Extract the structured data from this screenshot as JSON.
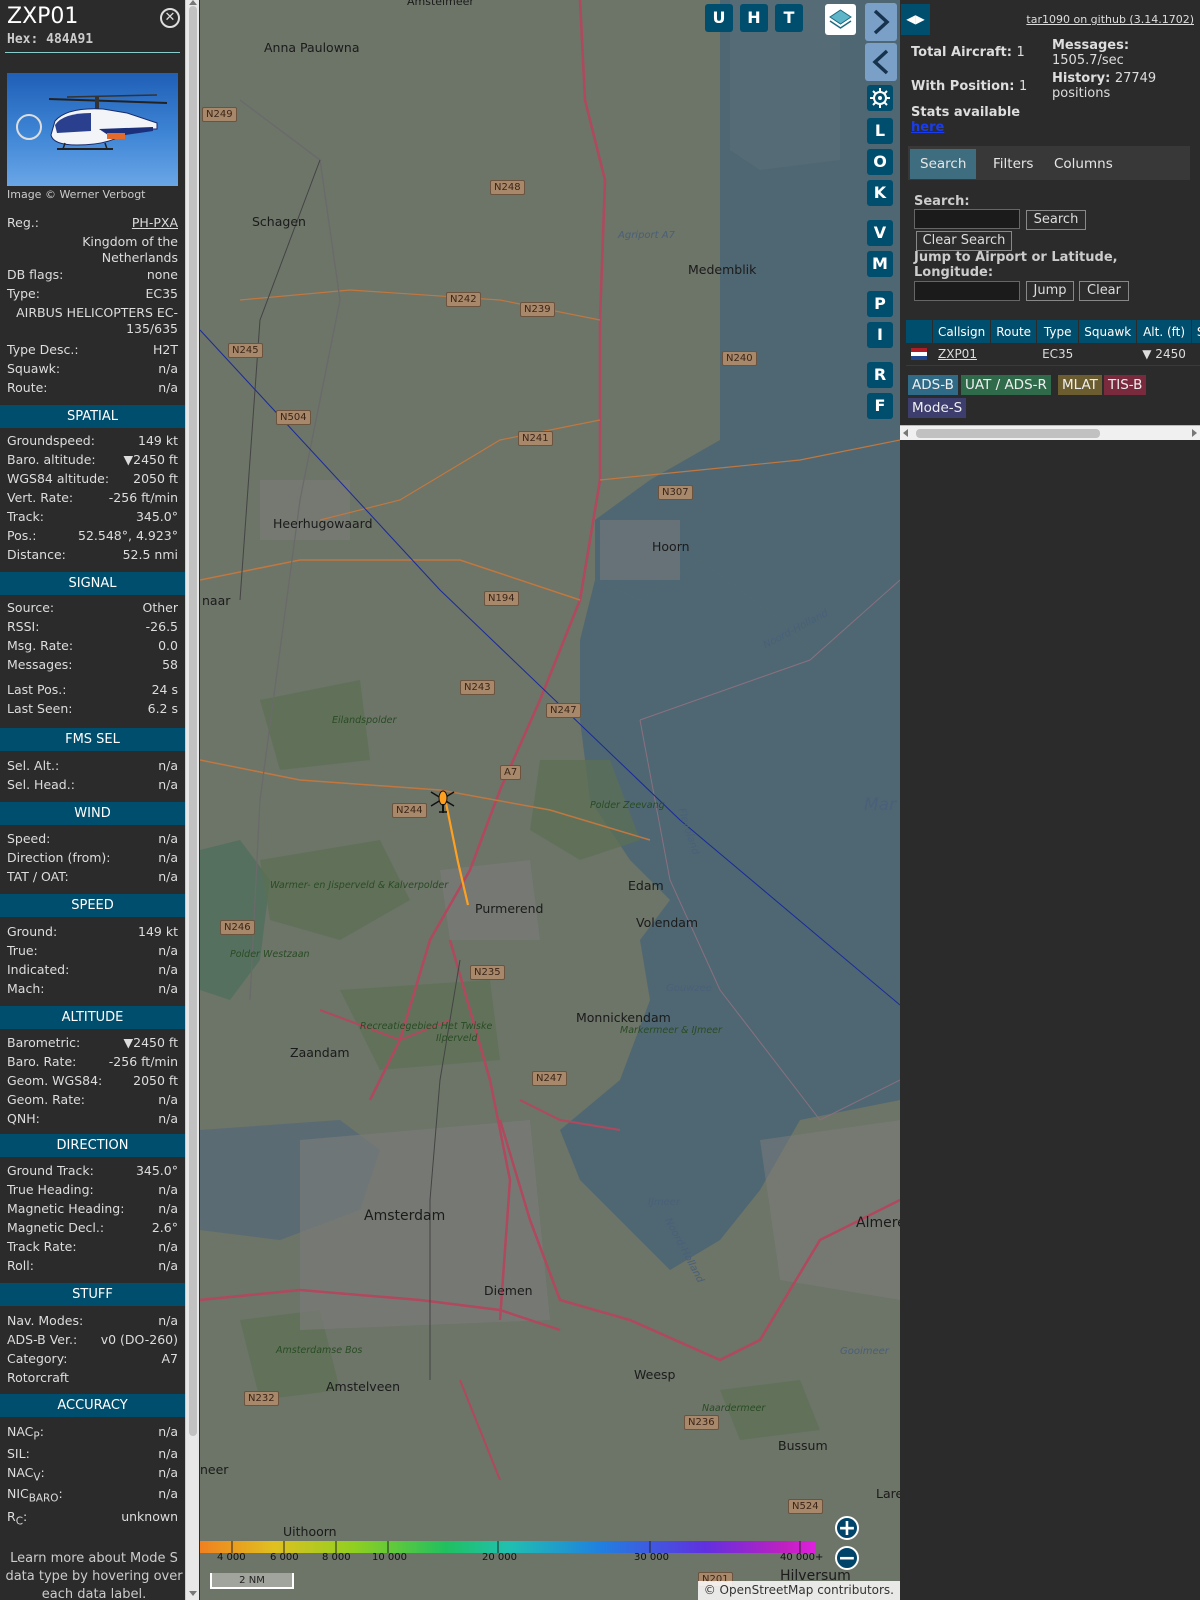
{
  "info": {
    "callsign": "ZXP01",
    "hex": "Hex: 484A91",
    "photo_credit": "Image © Werner Verbogt",
    "rows_top": [
      {
        "k": "Reg.:",
        "v": "PH-PXA"
      },
      {
        "k": "",
        "v": "Kingdom of the Netherlands"
      },
      {
        "k": "DB flags:",
        "v": "none"
      },
      {
        "k": "Type:",
        "v": "EC35"
      },
      {
        "k": "",
        "v": "AIRBUS HELICOPTERS EC-135/635"
      },
      {
        "k": "Type Desc.:",
        "v": "H2T"
      },
      {
        "k": "Squawk:",
        "v": "n/a"
      },
      {
        "k": "Route:",
        "v": "n/a"
      }
    ],
    "sections": {
      "spatial": "SPATIAL",
      "signal": "SIGNAL",
      "fms": "FMS SEL",
      "wind": "WIND",
      "speed": "SPEED",
      "altitude": "ALTITUDE",
      "direction": "DIRECTION",
      "stuff": "STUFF",
      "accuracy": "ACCURACY"
    },
    "spatial": [
      {
        "k": "Groundspeed:",
        "v": "149 kt"
      },
      {
        "k": "Baro. altitude:",
        "v": "▼2450 ft"
      },
      {
        "k": "WGS84 altitude:",
        "v": "2050 ft"
      },
      {
        "k": "Vert. Rate:",
        "v": "-256 ft/min"
      },
      {
        "k": "Track:",
        "v": "345.0°"
      },
      {
        "k": "Pos.:",
        "v": "52.548°, 4.923°"
      },
      {
        "k": "Distance:",
        "v": "52.5 nmi"
      }
    ],
    "signal": [
      {
        "k": "Source:",
        "v": "Other"
      },
      {
        "k": "RSSI:",
        "v": "-26.5"
      },
      {
        "k": "Msg. Rate:",
        "v": "0.0"
      },
      {
        "k": "Messages:",
        "v": "58"
      },
      {
        "k": "Last Pos.:",
        "v": "24 s"
      },
      {
        "k": "Last Seen:",
        "v": "6.2 s"
      }
    ],
    "fms": [
      {
        "k": "Sel. Alt.:",
        "v": "n/a"
      },
      {
        "k": "Sel. Head.:",
        "v": "n/a"
      }
    ],
    "wind": [
      {
        "k": "Speed:",
        "v": "n/a"
      },
      {
        "k": "Direction (from):",
        "v": "n/a"
      },
      {
        "k": "TAT / OAT:",
        "v": "n/a"
      }
    ],
    "speed": [
      {
        "k": "Ground:",
        "v": "149 kt"
      },
      {
        "k": "True:",
        "v": "n/a"
      },
      {
        "k": "Indicated:",
        "v": "n/a"
      },
      {
        "k": "Mach:",
        "v": "n/a"
      }
    ],
    "altitude": [
      {
        "k": "Barometric:",
        "v": "▼2450 ft"
      },
      {
        "k": "Baro. Rate:",
        "v": "-256 ft/min"
      },
      {
        "k": "Geom. WGS84:",
        "v": "2050 ft"
      },
      {
        "k": "Geom. Rate:",
        "v": "n/a"
      },
      {
        "k": "QNH:",
        "v": "n/a"
      }
    ],
    "direction": [
      {
        "k": "Ground Track:",
        "v": "345.0°"
      },
      {
        "k": "True Heading:",
        "v": "n/a"
      },
      {
        "k": "Magnetic Heading:",
        "v": "n/a"
      },
      {
        "k": "Magnetic Decl.:",
        "v": "2.6°"
      },
      {
        "k": "Track Rate:",
        "v": "n/a"
      },
      {
        "k": "Roll:",
        "v": "n/a"
      }
    ],
    "stuff": [
      {
        "k": "Nav. Modes:",
        "v": "n/a"
      },
      {
        "k": "ADS-B Ver.:",
        "v": "v0 (DO-260)"
      },
      {
        "k": "Category:",
        "v": "A7"
      },
      {
        "k": "Rotorcraft",
        "v": ""
      }
    ],
    "accuracy": [
      {
        "k": "NAC",
        "sub": "P",
        "v": "n/a"
      },
      {
        "k": "SIL:",
        "sub": "",
        "v": "n/a"
      },
      {
        "k": "NAC",
        "sub": "V",
        "v": "n/a"
      },
      {
        "k": "NIC",
        "sub": "BARO",
        "v": "n/a"
      },
      {
        "k": "R",
        "sub": "C",
        "v": "unknown"
      }
    ],
    "footnote": "Learn more about Mode S data type by hovering over each data label."
  },
  "map": {
    "buttons": {
      "u": "U",
      "h": "H",
      "t": "T",
      "l": "L",
      "o": "O",
      "k": "K",
      "v": "V",
      "m": "M",
      "p": "P",
      "i": "I",
      "r": "R",
      "f": "F"
    },
    "places": [
      {
        "id": "amstelmeer",
        "t": "Amstelmeer"
      },
      {
        "id": "anna",
        "t": "Anna Paulowna"
      },
      {
        "id": "schagen",
        "t": "Schagen"
      },
      {
        "id": "agriport",
        "t": "Agriport A7"
      },
      {
        "id": "medemblik",
        "t": "Medemblik"
      },
      {
        "id": "heerhugowaard",
        "t": "Heerhugowaard"
      },
      {
        "id": "hoorn",
        "t": "Hoorn"
      },
      {
        "id": "naar",
        "t": "naar"
      },
      {
        "id": "eilandspolder",
        "t": "Eilandspolder"
      },
      {
        "id": "purmerend",
        "t": "Purmerend"
      },
      {
        "id": "edam",
        "t": "Edam"
      },
      {
        "id": "volendam",
        "t": "Volendam"
      },
      {
        "id": "zaandam",
        "t": "Zaandam"
      },
      {
        "id": "monnickendam",
        "t": "Monnickendam"
      },
      {
        "id": "amsterdam",
        "t": "Amsterdam"
      },
      {
        "id": "diemen",
        "t": "Diemen"
      },
      {
        "id": "amstelveen",
        "t": "Amstelveen"
      },
      {
        "id": "weesp",
        "t": "Weesp"
      },
      {
        "id": "bussum",
        "t": "Bussum"
      },
      {
        "id": "hilversum",
        "t": "Hilversum"
      },
      {
        "id": "uithoorn",
        "t": "Uithoorn"
      },
      {
        "id": "almere",
        "t": "Almere"
      },
      {
        "id": "marken",
        "t": "Mar"
      },
      {
        "id": "neer",
        "t": "neer"
      },
      {
        "id": "laren",
        "t": "Larer"
      }
    ],
    "water": [
      {
        "id": "noordholland1",
        "t": "Noord-Holland"
      },
      {
        "id": "flevoland",
        "t": "Flevoland"
      },
      {
        "id": "gouwzee",
        "t": "Gouwzee"
      },
      {
        "id": "ijmeer",
        "t": "IJmeer"
      },
      {
        "id": "noordholland2",
        "t": "Noord-Holland"
      },
      {
        "id": "gooimeer",
        "t": "Gooimeer"
      }
    ],
    "parks": [
      {
        "id": "zeevang",
        "t": "Polder Zeevang"
      },
      {
        "id": "warmer",
        "t": "Warmer- en Jisperveld & Kalverpolder"
      },
      {
        "id": "westzaan",
        "t": "Polder Westzaan"
      },
      {
        "id": "twiske",
        "t": "Recreatiegebied Het Twiske"
      },
      {
        "id": "ilperveld",
        "t": "Ilperveld"
      },
      {
        "id": "markermeer",
        "t": "Markermeer & IJmeer"
      },
      {
        "id": "amsterdamsebos",
        "t": "Amsterdamse Bos"
      },
      {
        "id": "naardermeer",
        "t": "Naardermeer"
      }
    ],
    "shields": [
      {
        "id": "n249",
        "t": "N249"
      },
      {
        "id": "n248",
        "t": "N248"
      },
      {
        "id": "n242",
        "t": "N242"
      },
      {
        "id": "n239",
        "t": "N239"
      },
      {
        "id": "n245",
        "t": "N245"
      },
      {
        "id": "n240",
        "t": "N240"
      },
      {
        "id": "n504",
        "t": "N504"
      },
      {
        "id": "n241",
        "t": "N241"
      },
      {
        "id": "n307",
        "t": "N307"
      },
      {
        "id": "n194",
        "t": "N194"
      },
      {
        "id": "n243",
        "t": "N243"
      },
      {
        "id": "n247a",
        "t": "N247"
      },
      {
        "id": "a7",
        "t": "A7"
      },
      {
        "id": "n244",
        "t": "N244"
      },
      {
        "id": "n246",
        "t": "N246"
      },
      {
        "id": "n235",
        "t": "N235"
      },
      {
        "id": "n247b",
        "t": "N247"
      },
      {
        "id": "n232",
        "t": "N232"
      },
      {
        "id": "n236",
        "t": "N236"
      },
      {
        "id": "n524",
        "t": "N524"
      },
      {
        "id": "n201",
        "t": "N201"
      }
    ],
    "alt_labels": [
      "4 000",
      "6 000",
      "8 000",
      "10 000",
      "20 000",
      "30 000",
      "40 000+"
    ],
    "scale": "2 NM",
    "attribution_pre": "© ",
    "attribution_link": "OpenStreetMap",
    "attribution_post": " contributors."
  },
  "right": {
    "toggle_icon": "◀▶",
    "github": "tar1090 on github (3.14.1702)",
    "total_aircraft_label": "Total Aircraft:",
    "total_aircraft": "1",
    "with_position_label": "With Position:",
    "with_position": "1",
    "stats_label": "Stats available",
    "stats_link": "here",
    "messages_label": "Messages:",
    "messages": "1505.7/sec",
    "history_label": "History:",
    "history": "27749 positions",
    "tabs": [
      "Search",
      "Filters",
      "Columns"
    ],
    "search_label": "Search:",
    "search_value": "",
    "search_button": "Search",
    "clear_search_button": "Clear Search",
    "jump_label": "Jump to Airport or Latitude, Longitude:",
    "jump_value": "",
    "jump_button": "Jump",
    "clear_button": "Clear",
    "table_headers": [
      "",
      "Callsign",
      "Route",
      "Type",
      "Squawk",
      "Alt. (ft)",
      "Spd"
    ],
    "table_rows": [
      {
        "callsign": "ZXP01",
        "route": "",
        "type": "EC35",
        "squawk": "",
        "alt": "▼ 2450",
        "spd": ""
      }
    ],
    "sources": [
      {
        "t": "ADS-B",
        "color": "#2f6b86"
      },
      {
        "t": "UAT / ADS-R",
        "color": "#2f6b4a"
      },
      {
        "t": "MLAT",
        "color": "#6b5d2f"
      },
      {
        "t": "TIS-B",
        "color": "#7a2a3d"
      },
      {
        "t": "Mode-S",
        "color": "#3d3d6e"
      }
    ]
  }
}
